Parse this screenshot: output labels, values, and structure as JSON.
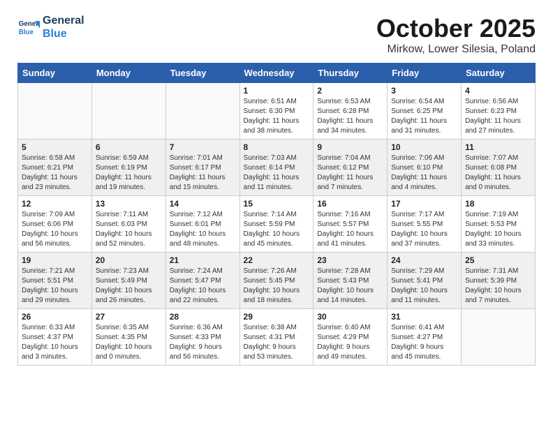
{
  "header": {
    "logo_line1": "General",
    "logo_line2": "Blue",
    "month": "October 2025",
    "location": "Mirkow, Lower Silesia, Poland"
  },
  "weekdays": [
    "Sunday",
    "Monday",
    "Tuesday",
    "Wednesday",
    "Thursday",
    "Friday",
    "Saturday"
  ],
  "weeks": [
    [
      {
        "day": "",
        "info": ""
      },
      {
        "day": "",
        "info": ""
      },
      {
        "day": "",
        "info": ""
      },
      {
        "day": "1",
        "info": "Sunrise: 6:51 AM\nSunset: 6:30 PM\nDaylight: 11 hours\nand 38 minutes."
      },
      {
        "day": "2",
        "info": "Sunrise: 6:53 AM\nSunset: 6:28 PM\nDaylight: 11 hours\nand 34 minutes."
      },
      {
        "day": "3",
        "info": "Sunrise: 6:54 AM\nSunset: 6:25 PM\nDaylight: 11 hours\nand 31 minutes."
      },
      {
        "day": "4",
        "info": "Sunrise: 6:56 AM\nSunset: 6:23 PM\nDaylight: 11 hours\nand 27 minutes."
      }
    ],
    [
      {
        "day": "5",
        "info": "Sunrise: 6:58 AM\nSunset: 6:21 PM\nDaylight: 11 hours\nand 23 minutes."
      },
      {
        "day": "6",
        "info": "Sunrise: 6:59 AM\nSunset: 6:19 PM\nDaylight: 11 hours\nand 19 minutes."
      },
      {
        "day": "7",
        "info": "Sunrise: 7:01 AM\nSunset: 6:17 PM\nDaylight: 11 hours\nand 15 minutes."
      },
      {
        "day": "8",
        "info": "Sunrise: 7:03 AM\nSunset: 6:14 PM\nDaylight: 11 hours\nand 11 minutes."
      },
      {
        "day": "9",
        "info": "Sunrise: 7:04 AM\nSunset: 6:12 PM\nDaylight: 11 hours\nand 7 minutes."
      },
      {
        "day": "10",
        "info": "Sunrise: 7:06 AM\nSunset: 6:10 PM\nDaylight: 11 hours\nand 4 minutes."
      },
      {
        "day": "11",
        "info": "Sunrise: 7:07 AM\nSunset: 6:08 PM\nDaylight: 11 hours\nand 0 minutes."
      }
    ],
    [
      {
        "day": "12",
        "info": "Sunrise: 7:09 AM\nSunset: 6:06 PM\nDaylight: 10 hours\nand 56 minutes."
      },
      {
        "day": "13",
        "info": "Sunrise: 7:11 AM\nSunset: 6:03 PM\nDaylight: 10 hours\nand 52 minutes."
      },
      {
        "day": "14",
        "info": "Sunrise: 7:12 AM\nSunset: 6:01 PM\nDaylight: 10 hours\nand 48 minutes."
      },
      {
        "day": "15",
        "info": "Sunrise: 7:14 AM\nSunset: 5:59 PM\nDaylight: 10 hours\nand 45 minutes."
      },
      {
        "day": "16",
        "info": "Sunrise: 7:16 AM\nSunset: 5:57 PM\nDaylight: 10 hours\nand 41 minutes."
      },
      {
        "day": "17",
        "info": "Sunrise: 7:17 AM\nSunset: 5:55 PM\nDaylight: 10 hours\nand 37 minutes."
      },
      {
        "day": "18",
        "info": "Sunrise: 7:19 AM\nSunset: 5:53 PM\nDaylight: 10 hours\nand 33 minutes."
      }
    ],
    [
      {
        "day": "19",
        "info": "Sunrise: 7:21 AM\nSunset: 5:51 PM\nDaylight: 10 hours\nand 29 minutes."
      },
      {
        "day": "20",
        "info": "Sunrise: 7:23 AM\nSunset: 5:49 PM\nDaylight: 10 hours\nand 26 minutes."
      },
      {
        "day": "21",
        "info": "Sunrise: 7:24 AM\nSunset: 5:47 PM\nDaylight: 10 hours\nand 22 minutes."
      },
      {
        "day": "22",
        "info": "Sunrise: 7:26 AM\nSunset: 5:45 PM\nDaylight: 10 hours\nand 18 minutes."
      },
      {
        "day": "23",
        "info": "Sunrise: 7:28 AM\nSunset: 5:43 PM\nDaylight: 10 hours\nand 14 minutes."
      },
      {
        "day": "24",
        "info": "Sunrise: 7:29 AM\nSunset: 5:41 PM\nDaylight: 10 hours\nand 11 minutes."
      },
      {
        "day": "25",
        "info": "Sunrise: 7:31 AM\nSunset: 5:39 PM\nDaylight: 10 hours\nand 7 minutes."
      }
    ],
    [
      {
        "day": "26",
        "info": "Sunrise: 6:33 AM\nSunset: 4:37 PM\nDaylight: 10 hours\nand 3 minutes."
      },
      {
        "day": "27",
        "info": "Sunrise: 6:35 AM\nSunset: 4:35 PM\nDaylight: 10 hours\nand 0 minutes."
      },
      {
        "day": "28",
        "info": "Sunrise: 6:36 AM\nSunset: 4:33 PM\nDaylight: 9 hours\nand 56 minutes."
      },
      {
        "day": "29",
        "info": "Sunrise: 6:38 AM\nSunset: 4:31 PM\nDaylight: 9 hours\nand 53 minutes."
      },
      {
        "day": "30",
        "info": "Sunrise: 6:40 AM\nSunset: 4:29 PM\nDaylight: 9 hours\nand 49 minutes."
      },
      {
        "day": "31",
        "info": "Sunrise: 6:41 AM\nSunset: 4:27 PM\nDaylight: 9 hours\nand 45 minutes."
      },
      {
        "day": "",
        "info": ""
      }
    ]
  ]
}
